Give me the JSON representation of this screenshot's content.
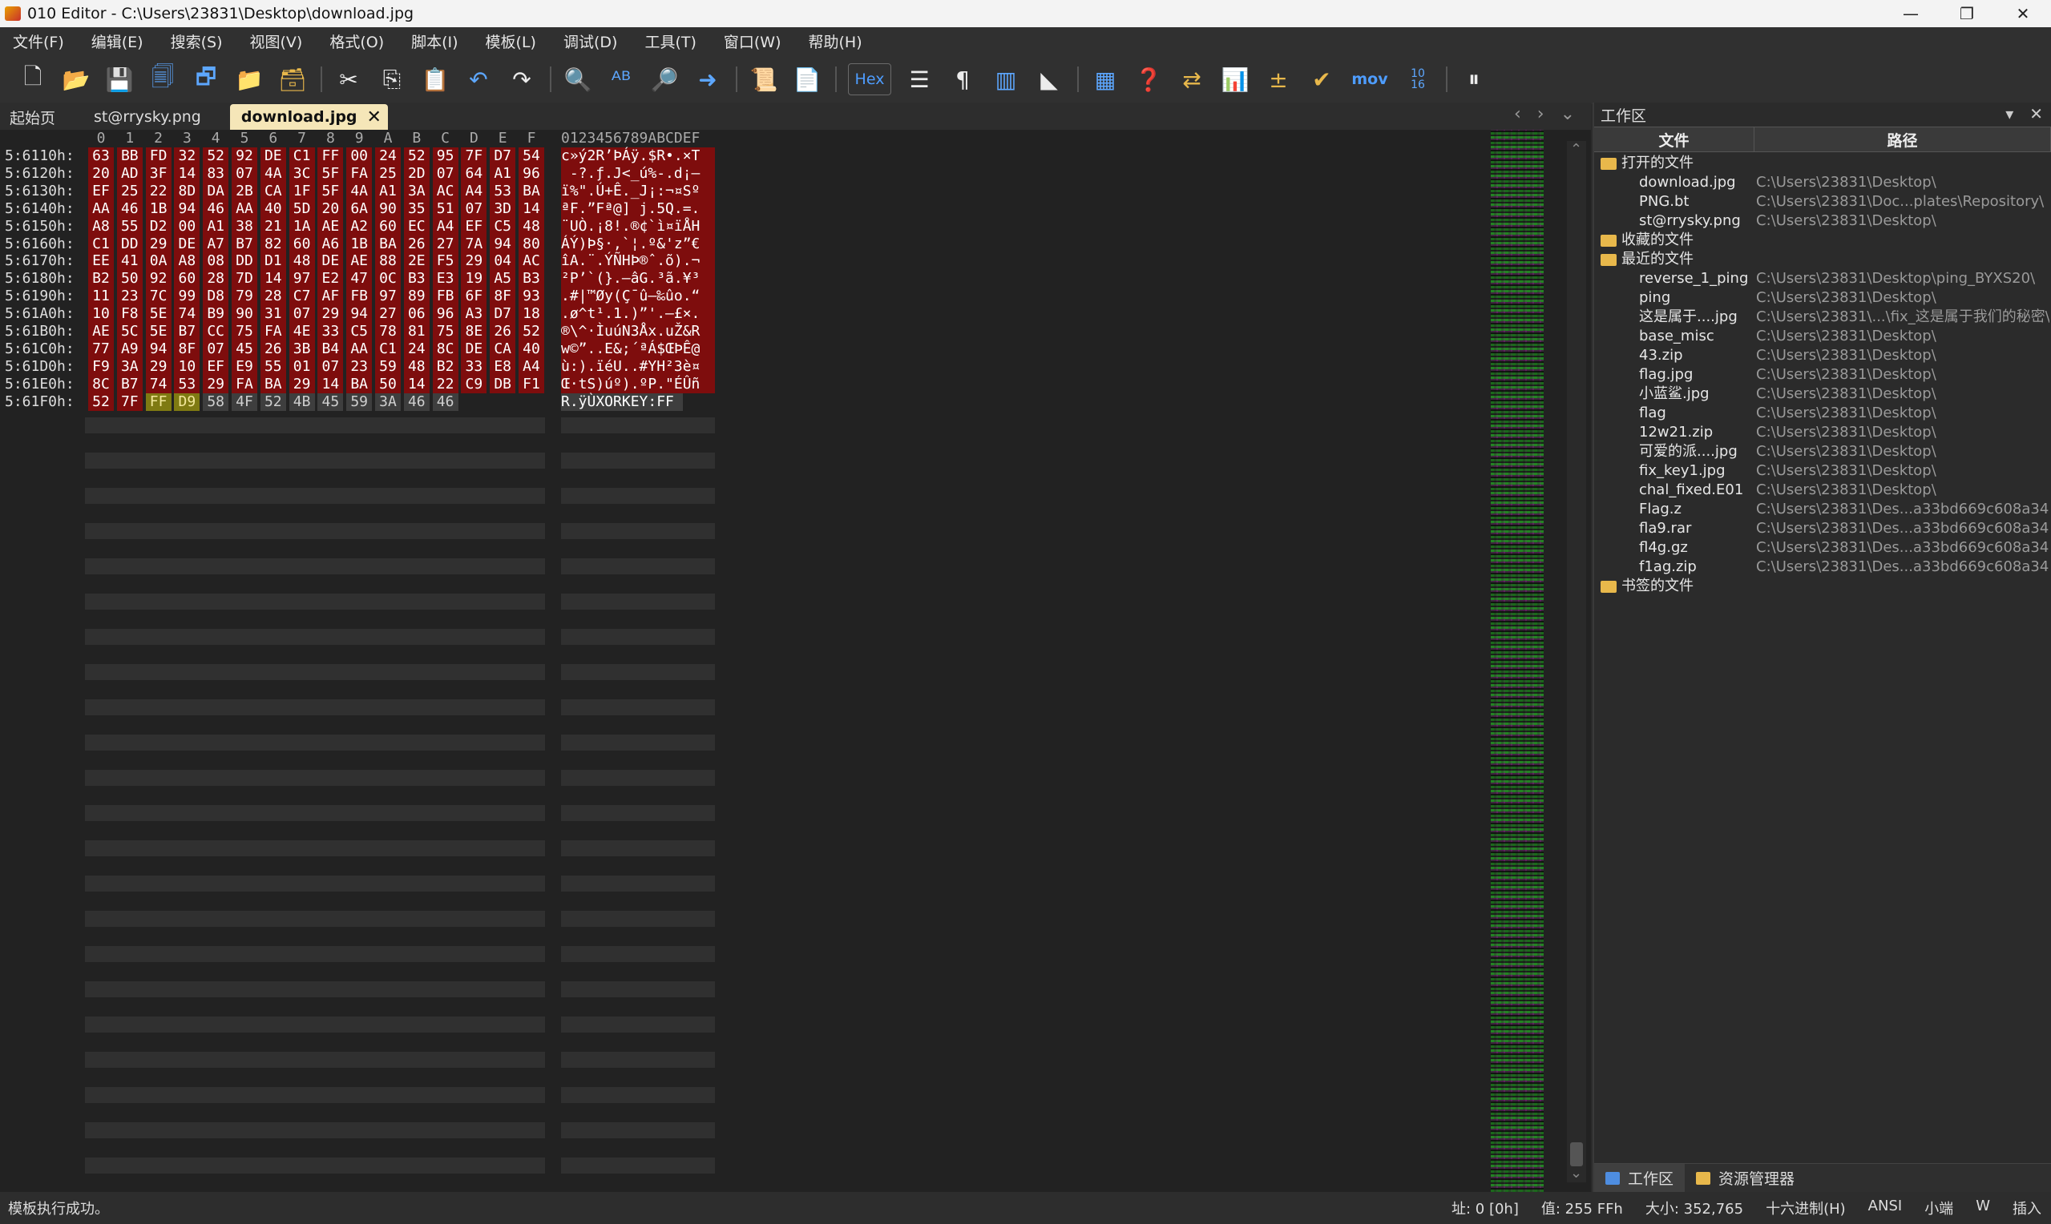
{
  "window": {
    "title": "010 Editor - C:\\Users\\23831\\Desktop\\download.jpg",
    "minimize": "—",
    "restore": "❐",
    "close": "✕"
  },
  "menu": [
    "文件(F)",
    "编辑(E)",
    "搜索(S)",
    "视图(V)",
    "格式(O)",
    "脚本(I)",
    "模板(L)",
    "调试(D)",
    "工具(T)",
    "窗口(W)",
    "帮助(H)"
  ],
  "toolbar": {
    "hex_label": "Hex",
    "mov_label": "mov",
    "base_label": "10 16"
  },
  "tabs": [
    {
      "label": "起始页",
      "active": false
    },
    {
      "label": "st@rrysky.png",
      "active": false
    },
    {
      "label": "download.jpg",
      "active": true
    }
  ],
  "hex": {
    "col_headers": [
      "0",
      "1",
      "2",
      "3",
      "4",
      "5",
      "6",
      "7",
      "8",
      "9",
      "A",
      "B",
      "C",
      "D",
      "E",
      "F"
    ],
    "ascii_header": "0123456789ABCDEF",
    "rows": [
      {
        "addr": "5:6110h:",
        "bytes": [
          "63",
          "BB",
          "FD",
          "32",
          "52",
          "92",
          "DE",
          "C1",
          "FF",
          "00",
          "24",
          "52",
          "95",
          "7F",
          "D7",
          "54"
        ],
        "ascii": "c»ý2R’ÞÁÿ.$R•.×T"
      },
      {
        "addr": "5:6120h:",
        "bytes": [
          "20",
          "AD",
          "3F",
          "14",
          "83",
          "07",
          "4A",
          "3C",
          "5F",
          "FA",
          "25",
          "2D",
          "07",
          "64",
          "A1",
          "96"
        ],
        "ascii": " -?.ƒ.J<_ú%-.d¡–"
      },
      {
        "addr": "5:6130h:",
        "bytes": [
          "EF",
          "25",
          "22",
          "8D",
          "DA",
          "2B",
          "CA",
          "1F",
          "5F",
          "4A",
          "A1",
          "3A",
          "AC",
          "A4",
          "53",
          "BA"
        ],
        "ascii": "ï%\".Ú+Ê._J¡:¬¤Sº"
      },
      {
        "addr": "5:6140h:",
        "bytes": [
          "AA",
          "46",
          "1B",
          "94",
          "46",
          "AA",
          "40",
          "5D",
          "20",
          "6A",
          "90",
          "35",
          "51",
          "07",
          "3D",
          "14"
        ],
        "ascii": "ªF.”Fª@] j.5Q.=."
      },
      {
        "addr": "5:6150h:",
        "bytes": [
          "A8",
          "55",
          "D2",
          "00",
          "A1",
          "38",
          "21",
          "1A",
          "AE",
          "A2",
          "60",
          "EC",
          "A4",
          "EF",
          "C5",
          "48"
        ],
        "ascii": "¨UÒ.¡8!.®¢`ì¤ïÅH"
      },
      {
        "addr": "5:6160h:",
        "bytes": [
          "C1",
          "DD",
          "29",
          "DE",
          "A7",
          "B7",
          "82",
          "60",
          "A6",
          "1B",
          "BA",
          "26",
          "27",
          "7A",
          "94",
          "80"
        ],
        "ascii": "ÁÝ)Þ§·‚`¦.º&'z”€"
      },
      {
        "addr": "5:6170h:",
        "bytes": [
          "EE",
          "41",
          "0A",
          "A8",
          "08",
          "DD",
          "D1",
          "48",
          "DE",
          "AE",
          "88",
          "2E",
          "F5",
          "29",
          "04",
          "AC"
        ],
        "ascii": "îA.¨.ÝÑHÞ®ˆ.õ).¬"
      },
      {
        "addr": "5:6180h:",
        "bytes": [
          "B2",
          "50",
          "92",
          "60",
          "28",
          "7D",
          "14",
          "97",
          "E2",
          "47",
          "0C",
          "B3",
          "E3",
          "19",
          "A5",
          "B3"
        ],
        "ascii": "²P’`(}.—âG.³ã.¥³"
      },
      {
        "addr": "5:6190h:",
        "bytes": [
          "11",
          "23",
          "7C",
          "99",
          "D8",
          "79",
          "28",
          "C7",
          "AF",
          "FB",
          "97",
          "89",
          "FB",
          "6F",
          "8F",
          "93"
        ],
        "ascii": ".#|™Øy(Ç¯û—‰ûo.“"
      },
      {
        "addr": "5:61A0h:",
        "bytes": [
          "10",
          "F8",
          "5E",
          "74",
          "B9",
          "90",
          "31",
          "07",
          "29",
          "94",
          "27",
          "06",
          "96",
          "A3",
          "D7",
          "18"
        ],
        "ascii": ".ø^t¹.1.)”'.–£×."
      },
      {
        "addr": "5:61B0h:",
        "bytes": [
          "AE",
          "5C",
          "5E",
          "B7",
          "CC",
          "75",
          "FA",
          "4E",
          "33",
          "C5",
          "78",
          "81",
          "75",
          "8E",
          "26",
          "52"
        ],
        "ascii": "®\\^·ÌuúN3Åx.uŽ&R"
      },
      {
        "addr": "5:61C0h:",
        "bytes": [
          "77",
          "A9",
          "94",
          "8F",
          "07",
          "45",
          "26",
          "3B",
          "B4",
          "AA",
          "C1",
          "24",
          "8C",
          "DE",
          "CA",
          "40"
        ],
        "ascii": "w©”..E&;´ªÁ$ŒÞÊ@"
      },
      {
        "addr": "5:61D0h:",
        "bytes": [
          "F9",
          "3A",
          "29",
          "10",
          "EF",
          "E9",
          "55",
          "01",
          "07",
          "23",
          "59",
          "48",
          "B2",
          "33",
          "E8",
          "A4"
        ],
        "ascii": "ù:).ïéU..#YH²3è¤"
      },
      {
        "addr": "5:61E0h:",
        "bytes": [
          "8C",
          "B7",
          "74",
          "53",
          "29",
          "FA",
          "BA",
          "29",
          "14",
          "BA",
          "50",
          "14",
          "22",
          "C9",
          "DB",
          "F1"
        ],
        "ascii": "Œ·tS)úº).ºP.\"ÉÛñ"
      },
      {
        "addr": "5:61F0h:",
        "bytes": [
          "52",
          "7F",
          "FF",
          "D9",
          "58",
          "4F",
          "52",
          "4B",
          "45",
          "59",
          "3A",
          "46",
          "46"
        ],
        "ascii": "R.ÿÙXORKEY:FF"
      }
    ]
  },
  "workspace": {
    "title": "工作区",
    "col_file": "文件",
    "col_path": "路径",
    "groups": {
      "open": "打开的文件",
      "favorites": "收藏的文件",
      "recent": "最近的文件",
      "bookmarks": "书签的文件"
    },
    "open_files": [
      {
        "name": "download.jpg",
        "path": "C:\\Users\\23831\\Desktop\\"
      },
      {
        "name": "PNG.bt",
        "path": "C:\\Users\\23831\\Doc...plates\\Repository\\"
      },
      {
        "name": "st@rrysky.png",
        "path": "C:\\Users\\23831\\Desktop\\"
      }
    ],
    "recent_files": [
      {
        "name": "reverse_1_ping",
        "path": "C:\\Users\\23831\\Desktop\\ping_BYXS20\\"
      },
      {
        "name": "ping",
        "path": "C:\\Users\\23831\\Desktop\\"
      },
      {
        "name": "这是属于....jpg",
        "path": "C:\\Users\\23831\\...\\fix_这是属于我们的秘密\\"
      },
      {
        "name": "base_misc",
        "path": "C:\\Users\\23831\\Desktop\\"
      },
      {
        "name": "43.zip",
        "path": "C:\\Users\\23831\\Desktop\\"
      },
      {
        "name": "flag.jpg",
        "path": "C:\\Users\\23831\\Desktop\\"
      },
      {
        "name": "小蓝鲨.jpg",
        "path": "C:\\Users\\23831\\Desktop\\"
      },
      {
        "name": "flag",
        "path": "C:\\Users\\23831\\Desktop\\"
      },
      {
        "name": "12w21.zip",
        "path": "C:\\Users\\23831\\Desktop\\"
      },
      {
        "name": "可爱的派....jpg",
        "path": "C:\\Users\\23831\\Desktop\\"
      },
      {
        "name": "fix_key1.jpg",
        "path": "C:\\Users\\23831\\Desktop\\"
      },
      {
        "name": "chal_fixed.E01",
        "path": "C:\\Users\\23831\\Desktop\\"
      },
      {
        "name": "Flag.z",
        "path": "C:\\Users\\23831\\Des...a33bd669c608a34c3\\"
      },
      {
        "name": "fla9.rar",
        "path": "C:\\Users\\23831\\Des...a33bd669c608a34c3\\"
      },
      {
        "name": "fl4g.gz",
        "path": "C:\\Users\\23831\\Des...a33bd669c608a34c3\\"
      },
      {
        "name": "f1ag.zip",
        "path": "C:\\Users\\23831\\Des...a33bd669c608a34c3\\"
      }
    ],
    "bottom_tabs": [
      "工作区",
      "资源管理器"
    ]
  },
  "status": {
    "message": "模板执行成功。",
    "address": "址: 0 [0h]",
    "value": "值: 255 FFh",
    "size": "大小: 352,765",
    "mode": "十六进制(H)",
    "encoding": "ANSI",
    "endian": "小端",
    "w": "W",
    "insert": "插入"
  },
  "colors": {
    "selection_red": "#7e0d0d",
    "highlight_yellow": "#7f7a12",
    "active_tab": "#f5e6b8"
  }
}
